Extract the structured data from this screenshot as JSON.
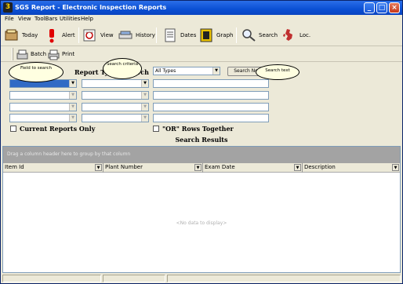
{
  "window": {
    "title": "SGS Report - Electronic Inspection Reports",
    "buttons": {
      "minimize": "_",
      "maximize": "□",
      "close": "×"
    }
  },
  "menu": [
    {
      "label": "File"
    },
    {
      "label": "View"
    },
    {
      "label": "ToolBars"
    },
    {
      "label": "Utilities"
    },
    {
      "label": "Help"
    }
  ],
  "toolbar": [
    {
      "label": "Today",
      "icon": "today-icon"
    },
    {
      "label": "Alert",
      "icon": "alert-icon"
    },
    {
      "label": "View",
      "icon": "view-icon"
    },
    {
      "label": "History",
      "icon": "history-icon"
    },
    {
      "label": "Dates",
      "icon": "dates-icon"
    },
    {
      "label": "Graph",
      "icon": "graph-icon"
    },
    {
      "label": "Search",
      "icon": "search-icon"
    },
    {
      "label": "Loc.",
      "icon": "location-map-icon"
    }
  ],
  "toolbar2": [
    {
      "label": "Batch",
      "icon": "batch-icon"
    },
    {
      "label": "Print",
      "icon": "print-icon"
    }
  ],
  "search": {
    "report_types_label": "Report Types",
    "search_label": "Search",
    "report_type_value": "All Types",
    "search_now_button": "Search Now",
    "current_reports_label": "Current Reports Only",
    "or_rows_label": "\"OR\" Rows Together"
  },
  "bubbles": {
    "field_to_search": "Field to search",
    "search_criteria": "Search criteria",
    "search_text": "Search text"
  },
  "results": {
    "title": "Search Results",
    "group_hint": "Drag a column header here to group by that column",
    "columns": [
      "Item Id",
      "Plant Number",
      "Exam Date",
      "Description"
    ],
    "empty_text": "<No data to display>"
  },
  "colors": {
    "title_bar": "#0a4fd4",
    "selection": "#316ac5",
    "group_area": "#a3a3a3",
    "tooltip": "#ffffe1"
  }
}
